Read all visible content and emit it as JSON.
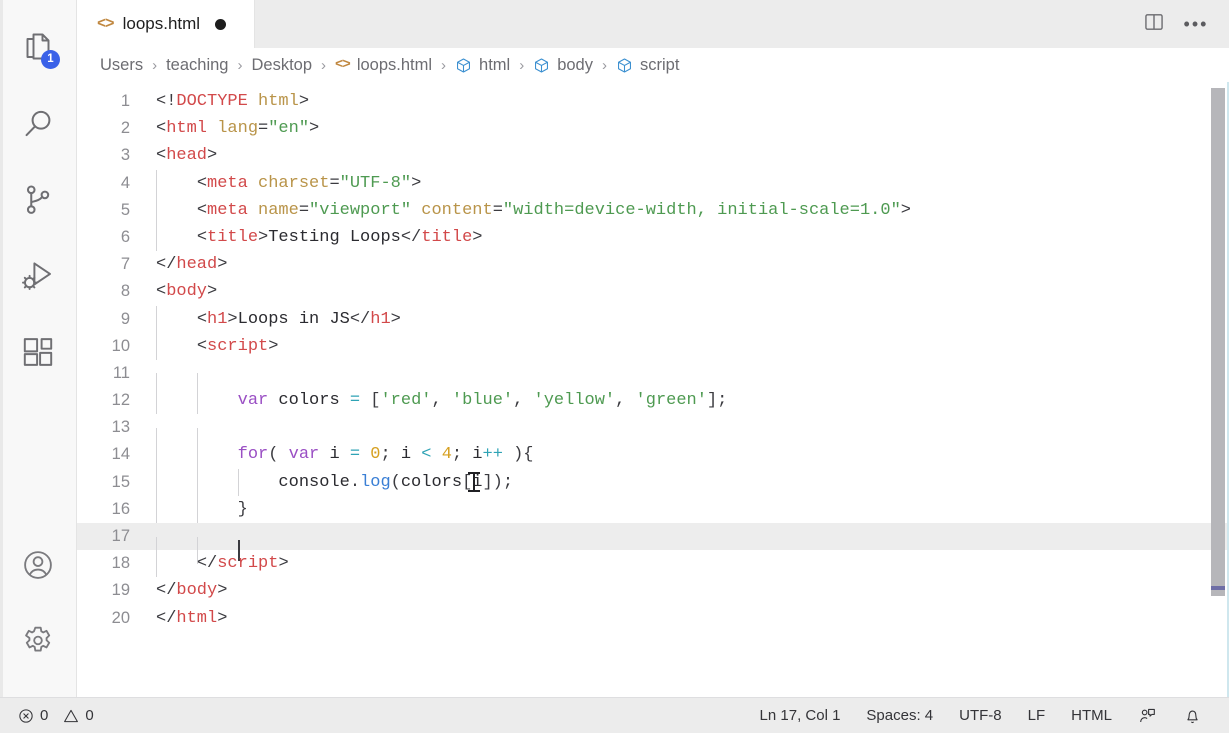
{
  "window": {
    "app": "Visual Studio Code",
    "theme_background": "#ffffff",
    "accent_badge_color": "#3a61e8"
  },
  "activity_bar": {
    "items": [
      {
        "name": "explorer",
        "icon": "files-icon",
        "badge": "1",
        "active": true
      },
      {
        "name": "search",
        "icon": "search-icon",
        "badge": "",
        "active": false
      },
      {
        "name": "source-control",
        "icon": "source-control-icon",
        "badge": "",
        "active": false
      },
      {
        "name": "run-and-debug",
        "icon": "run-debug-icon",
        "badge": "",
        "active": false
      },
      {
        "name": "extensions",
        "icon": "extensions-icon",
        "badge": "",
        "active": false
      }
    ],
    "bottom_items": [
      {
        "name": "accounts",
        "icon": "account-icon"
      },
      {
        "name": "manage",
        "icon": "gear-icon"
      }
    ]
  },
  "tab_bar": {
    "tabs": [
      {
        "icon": "html-code-icon",
        "label": "loops.html",
        "dirty": true,
        "active": true
      }
    ],
    "actions": [
      {
        "name": "split-editor",
        "icon": "split-editor-icon"
      },
      {
        "name": "more-actions",
        "icon": "ellipsis-icon",
        "glyph": "•••"
      }
    ]
  },
  "breadcrumbs": {
    "separator": "›",
    "items": [
      {
        "label": "Users",
        "icon": ""
      },
      {
        "label": "teaching",
        "icon": ""
      },
      {
        "label": "Desktop",
        "icon": ""
      },
      {
        "label": "loops.html",
        "icon": "html-code-icon"
      },
      {
        "label": "html",
        "icon": "symbol-cube-icon"
      },
      {
        "label": "body",
        "icon": "symbol-cube-icon"
      },
      {
        "label": "script",
        "icon": "symbol-cube-icon"
      }
    ]
  },
  "editor": {
    "language": "HTML",
    "current_line": 17,
    "first_line": 1,
    "last_line": 20,
    "lines": [
      {
        "n": "1",
        "guides": 0,
        "tokens": [
          {
            "c": "punc",
            "t": "<!"
          },
          {
            "c": "doctype",
            "t": "DOCTYPE"
          },
          {
            "c": "attr",
            "t": " html"
          },
          {
            "c": "punc",
            "t": ">"
          }
        ]
      },
      {
        "n": "2",
        "guides": 0,
        "tokens": [
          {
            "c": "punc",
            "t": "<"
          },
          {
            "c": "tag",
            "t": "html"
          },
          {
            "c": "attr",
            "t": " lang"
          },
          {
            "c": "punc",
            "t": "="
          },
          {
            "c": "str",
            "t": "\"en\""
          },
          {
            "c": "punc",
            "t": ">"
          }
        ]
      },
      {
        "n": "3",
        "guides": 0,
        "tokens": [
          {
            "c": "punc",
            "t": "<"
          },
          {
            "c": "tag",
            "t": "head"
          },
          {
            "c": "punc",
            "t": ">"
          }
        ]
      },
      {
        "n": "4",
        "guides": 1,
        "tokens": [
          {
            "c": "text",
            "t": "    "
          },
          {
            "c": "punc",
            "t": "<"
          },
          {
            "c": "tag",
            "t": "meta"
          },
          {
            "c": "attr",
            "t": " charset"
          },
          {
            "c": "punc",
            "t": "="
          },
          {
            "c": "str",
            "t": "\"UTF-8\""
          },
          {
            "c": "punc",
            "t": ">"
          }
        ]
      },
      {
        "n": "5",
        "guides": 1,
        "tokens": [
          {
            "c": "text",
            "t": "    "
          },
          {
            "c": "punc",
            "t": "<"
          },
          {
            "c": "tag",
            "t": "meta"
          },
          {
            "c": "attr",
            "t": " name"
          },
          {
            "c": "punc",
            "t": "="
          },
          {
            "c": "str",
            "t": "\"viewport\""
          },
          {
            "c": "attr",
            "t": " content"
          },
          {
            "c": "punc",
            "t": "="
          },
          {
            "c": "str",
            "t": "\"width=device-width, initial-scale=1.0\""
          },
          {
            "c": "punc",
            "t": ">"
          }
        ]
      },
      {
        "n": "6",
        "guides": 1,
        "tokens": [
          {
            "c": "text",
            "t": "    "
          },
          {
            "c": "punc",
            "t": "<"
          },
          {
            "c": "tag",
            "t": "title"
          },
          {
            "c": "punc",
            "t": ">"
          },
          {
            "c": "text",
            "t": "Testing Loops"
          },
          {
            "c": "punc",
            "t": "</"
          },
          {
            "c": "tag",
            "t": "title"
          },
          {
            "c": "punc",
            "t": ">"
          }
        ]
      },
      {
        "n": "7",
        "guides": 0,
        "tokens": [
          {
            "c": "punc",
            "t": "</"
          },
          {
            "c": "tag",
            "t": "head"
          },
          {
            "c": "punc",
            "t": ">"
          }
        ]
      },
      {
        "n": "8",
        "guides": 0,
        "tokens": [
          {
            "c": "punc",
            "t": "<"
          },
          {
            "c": "tag",
            "t": "body"
          },
          {
            "c": "punc",
            "t": ">"
          }
        ]
      },
      {
        "n": "9",
        "guides": 1,
        "tokens": [
          {
            "c": "text",
            "t": "    "
          },
          {
            "c": "punc",
            "t": "<"
          },
          {
            "c": "tag",
            "t": "h1"
          },
          {
            "c": "punc",
            "t": ">"
          },
          {
            "c": "text",
            "t": "Loops in JS"
          },
          {
            "c": "punc",
            "t": "</"
          },
          {
            "c": "tag",
            "t": "h1"
          },
          {
            "c": "punc",
            "t": ">"
          }
        ]
      },
      {
        "n": "10",
        "guides": 1,
        "tokens": [
          {
            "c": "text",
            "t": "    "
          },
          {
            "c": "punc",
            "t": "<"
          },
          {
            "c": "tag",
            "t": "script"
          },
          {
            "c": "punc",
            "t": ">"
          }
        ]
      },
      {
        "n": "11",
        "guides": 2,
        "tokens": []
      },
      {
        "n": "12",
        "guides": 2,
        "tokens": [
          {
            "c": "text",
            "t": "        "
          },
          {
            "c": "kw",
            "t": "var"
          },
          {
            "c": "var",
            "t": " colors "
          },
          {
            "c": "op",
            "t": "="
          },
          {
            "c": "punc",
            "t": " ["
          },
          {
            "c": "str",
            "t": "'red'"
          },
          {
            "c": "punc",
            "t": ", "
          },
          {
            "c": "str",
            "t": "'blue'"
          },
          {
            "c": "punc",
            "t": ", "
          },
          {
            "c": "str",
            "t": "'yellow'"
          },
          {
            "c": "punc",
            "t": ", "
          },
          {
            "c": "str",
            "t": "'green'"
          },
          {
            "c": "punc",
            "t": "];"
          }
        ]
      },
      {
        "n": "13",
        "guides": 2,
        "tokens": []
      },
      {
        "n": "14",
        "guides": 2,
        "tokens": [
          {
            "c": "text",
            "t": "        "
          },
          {
            "c": "kw",
            "t": "for"
          },
          {
            "c": "punc",
            "t": "( "
          },
          {
            "c": "kw",
            "t": "var"
          },
          {
            "c": "var",
            "t": " i "
          },
          {
            "c": "op",
            "t": "="
          },
          {
            "c": "text",
            "t": " "
          },
          {
            "c": "num",
            "t": "0"
          },
          {
            "c": "punc",
            "t": "; "
          },
          {
            "c": "var",
            "t": "i "
          },
          {
            "c": "op",
            "t": "<"
          },
          {
            "c": "text",
            "t": " "
          },
          {
            "c": "num",
            "t": "4"
          },
          {
            "c": "punc",
            "t": "; "
          },
          {
            "c": "var",
            "t": "i"
          },
          {
            "c": "op",
            "t": "++"
          },
          {
            "c": "punc",
            "t": " ){"
          }
        ]
      },
      {
        "n": "15",
        "guides": 3,
        "tokens": [
          {
            "c": "text",
            "t": "            "
          },
          {
            "c": "var",
            "t": "console"
          },
          {
            "c": "punc",
            "t": "."
          },
          {
            "c": "fn",
            "t": "log"
          },
          {
            "c": "punc",
            "t": "("
          },
          {
            "c": "var",
            "t": "colors"
          },
          {
            "c": "punc",
            "t": "["
          },
          {
            "c": "var",
            "t": "i"
          },
          {
            "c": "punc",
            "t": "]);"
          }
        ]
      },
      {
        "n": "16",
        "guides": 2,
        "tokens": [
          {
            "c": "text",
            "t": "        "
          },
          {
            "c": "punc",
            "t": "}"
          }
        ]
      },
      {
        "n": "17",
        "guides": 2,
        "tokens": [],
        "current": true,
        "caret": true
      },
      {
        "n": "18",
        "guides": 1,
        "tokens": [
          {
            "c": "text",
            "t": "    "
          },
          {
            "c": "punc",
            "t": "</"
          },
          {
            "c": "tag",
            "t": "script"
          },
          {
            "c": "punc",
            "t": ">"
          }
        ]
      },
      {
        "n": "19",
        "guides": 0,
        "tokens": [
          {
            "c": "punc",
            "t": "</"
          },
          {
            "c": "tag",
            "t": "body"
          },
          {
            "c": "punc",
            "t": ">"
          }
        ]
      },
      {
        "n": "20",
        "guides": 0,
        "tokens": [
          {
            "c": "punc",
            "t": "</"
          },
          {
            "c": "tag",
            "t": "html"
          },
          {
            "c": "punc",
            "t": ">"
          }
        ]
      }
    ]
  },
  "status_bar": {
    "left": [
      {
        "name": "problems-errors",
        "icon": "error-circle-icon",
        "label": "0"
      },
      {
        "name": "problems-warnings",
        "icon": "warning-triangle-icon",
        "label": "0"
      }
    ],
    "right": [
      {
        "name": "cursor-position",
        "label": "Ln 17, Col 1"
      },
      {
        "name": "indentation",
        "label": "Spaces: 4"
      },
      {
        "name": "encoding",
        "label": "UTF-8"
      },
      {
        "name": "end-of-line",
        "label": "LF"
      },
      {
        "name": "language-mode",
        "label": "HTML"
      },
      {
        "name": "feedback",
        "icon": "feedback-person-icon",
        "label": ""
      },
      {
        "name": "notifications",
        "icon": "bell-icon",
        "label": ""
      }
    ]
  }
}
